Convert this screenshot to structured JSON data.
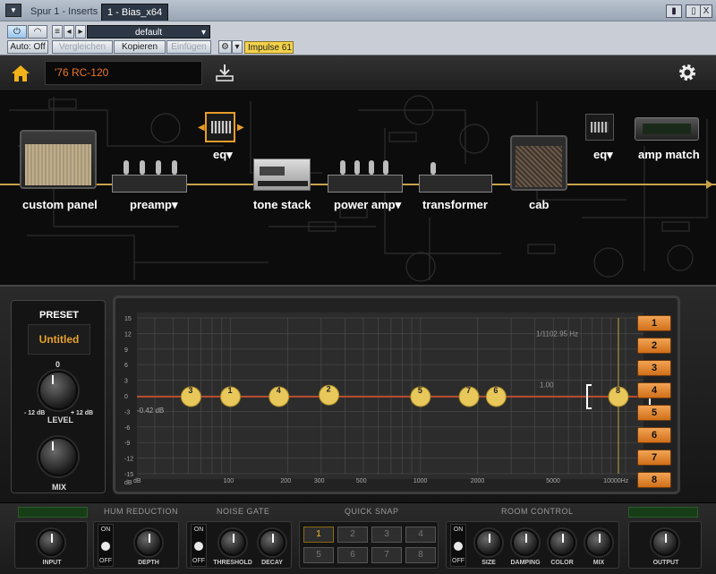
{
  "host": {
    "menu_icon": "menu-arrow-icon",
    "track": "Spur 1 - Inserts",
    "plugin_tab": "1 - Bias_x64",
    "pin_label": "❙",
    "close_label": "X",
    "preset_dropdown": "default",
    "auto_off": "Auto: Off",
    "compare": "Vergleichen",
    "copy": "Kopieren",
    "paste": "Einfügen",
    "sidechain": "Impulse 61"
  },
  "header": {
    "preset_name": "'76 RC-120"
  },
  "chain": {
    "items": [
      "custom panel",
      "preamp",
      "eq",
      "tone stack",
      "power amp",
      "transformer",
      "cab",
      "eq",
      "amp match"
    ]
  },
  "preset": {
    "title": "PRESET",
    "value": "Untitled",
    "level_label": "LEVEL",
    "level_min": "- 12 dB",
    "level_max": "+ 12 dB",
    "level_top": "0",
    "mix_label": "MIX"
  },
  "eq_chart": {
    "y_ticks": [
      "15",
      "12",
      "9",
      "6",
      "3",
      "0",
      "-3",
      "-6",
      "-9",
      "-12",
      "-15",
      "dB"
    ],
    "x_ticks": [
      "100",
      "200",
      "300",
      "500",
      "1000",
      "2000",
      "5000",
      "10000Hz"
    ],
    "readout_freq": "1/1102.95 Hz",
    "readout_q": "1.00",
    "gain_readout": "-0.42 dB",
    "nodes": [
      {
        "id": "3",
        "freq": 62,
        "gain": 0
      },
      {
        "id": "1",
        "freq": 100,
        "gain": 0
      },
      {
        "id": "4",
        "freq": 180,
        "gain": 0
      },
      {
        "id": "2",
        "freq": 330,
        "gain": 0.3
      },
      {
        "id": "5",
        "freq": 1000,
        "gain": 0
      },
      {
        "id": "7",
        "freq": 1800,
        "gain": 0
      },
      {
        "id": "6",
        "freq": 2500,
        "gain": 0
      },
      {
        "id": "8",
        "freq": 11000,
        "gain": 0
      }
    ]
  },
  "bands": [
    "1",
    "2",
    "3",
    "4",
    "5",
    "6",
    "7",
    "8"
  ],
  "bottom": {
    "hum": "HUM REDUCTION",
    "gate": "NOISE GATE",
    "snap": "QUICK SNAP",
    "room": "ROOM CONTROL",
    "input": "INPUT",
    "depth": "DEPTH",
    "threshold": "THRESHOLD",
    "decay": "DECAY",
    "size": "SIZE",
    "damping": "DAMPING",
    "color": "COLOR",
    "mix": "MIX",
    "output": "OUTPUT",
    "on": "ON",
    "off": "OFF",
    "snaps": [
      "1",
      "2",
      "3",
      "4",
      "5",
      "6",
      "7",
      "8"
    ]
  }
}
